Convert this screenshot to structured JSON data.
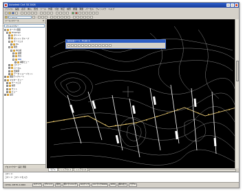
{
  "window": {
    "title": "Autodesk Civil 3D 2008"
  },
  "menu": [
    "ファイル",
    "編集",
    "表示",
    "挿入",
    "形式",
    "ツール",
    "作図",
    "寸法",
    "修正",
    "線形",
    "断面",
    "測量",
    "パーセル",
    "ウィンドウ",
    "ヘルプ"
  ],
  "toolbar": {
    "layer_value": "C-ROAD"
  },
  "sidebar": {
    "title": "ツールスペース",
    "search_value": "プロスペクター",
    "tree": [
      {
        "label": "オープン図面",
        "level": 0,
        "exp": "-"
      },
      {
        "label": "Drawing1",
        "level": 1,
        "exp": "-"
      },
      {
        "label": "ポイント",
        "level": 2,
        "exp": "+"
      },
      {
        "label": "ポイント グループ",
        "level": 2,
        "exp": "+"
      },
      {
        "label": "サーフェス",
        "level": 2,
        "exp": "-"
      },
      {
        "label": "EG",
        "level": 3,
        "exp": "+"
      },
      {
        "label": "線形",
        "level": 2,
        "exp": "-"
      },
      {
        "label": "中心線",
        "level": 3,
        "exp": "-"
      },
      {
        "label": "縦断",
        "level": 4,
        "exp": "+"
      },
      {
        "label": "測点",
        "level": 4,
        "exp": "+"
      },
      {
        "label": "横断",
        "level": 4,
        "exp": "-",
        "selected": true
      },
      {
        "label": "横断ビュー",
        "level": 5,
        "exp": "+"
      },
      {
        "label": "コリドー",
        "level": 2,
        "exp": "+"
      },
      {
        "label": "パーセル",
        "level": 2,
        "exp": "+"
      },
      {
        "label": "管路網",
        "level": 2,
        "exp": "+"
      },
      {
        "label": "データ ショートカット",
        "level": 2,
        "exp": "+"
      },
      {
        "label": "図面テンプレート",
        "level": 0,
        "exp": "+"
      },
      {
        "label": "マスター ビュー",
        "level": 0,
        "exp": "+"
      },
      {
        "label": "サーフェス",
        "level": 1,
        "exp": "+"
      },
      {
        "label": "線形",
        "level": 1,
        "exp": "+"
      },
      {
        "label": "サイト",
        "level": 1,
        "exp": "+"
      },
      {
        "label": "ビュー",
        "level": 1,
        "exp": "+"
      },
      {
        "label": "設定",
        "level": 0,
        "exp": "+"
      }
    ],
    "footer": "プロスペクター  設定  測量"
  },
  "palette": {
    "title": "線形配置ツール - 中心線 (1)"
  },
  "tabs": [
    "モデル",
    "レイアウト1",
    "レイアウト2"
  ],
  "command": {
    "line1": "コマンド:",
    "line2": "コマンド: コマンドを入力"
  },
  "status": {
    "coords": "19794, 20578, 0.0000",
    "toggles": [
      "スナップ",
      "グリッド",
      "直交",
      "極トラッキング",
      "Oスナップ",
      "OトラックDUCS",
      "DYN",
      "線の太さ",
      "モデル"
    ]
  }
}
